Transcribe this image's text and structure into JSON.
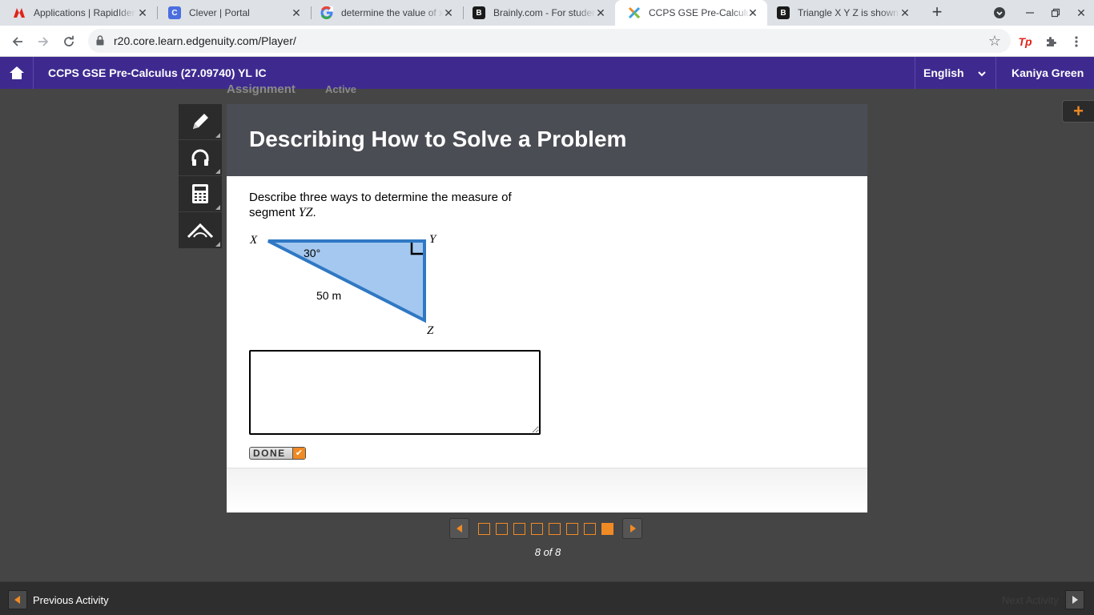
{
  "browser": {
    "tabs": [
      {
        "title": "Applications | RapidIdentity",
        "icon": "rapididentity-icon"
      },
      {
        "title": "Clever | Portal",
        "icon": "clever-icon"
      },
      {
        "title": "determine the value of x",
        "icon": "google-icon"
      },
      {
        "title": "Brainly.com - For students",
        "icon": "brainly-icon"
      },
      {
        "title": "CCPS GSE Pre-Calculus",
        "icon": "edgenuity-icon"
      },
      {
        "title": "Triangle X Y Z is shown",
        "icon": "brainly-icon"
      }
    ],
    "active_tab": 4,
    "url": "r20.core.learn.edgenuity.com/Player/"
  },
  "header": {
    "course_title": "CCPS GSE Pre-Calculus (27.09740) YL IC",
    "language": "English",
    "user": "Kaniya Green",
    "behind_left": "Assignment",
    "behind_right": "Active"
  },
  "activity": {
    "title": "Describing How to Solve a Problem",
    "prompt_text": "Describe three ways to determine the measure of segment ",
    "prompt_var": "YZ",
    "prompt_end": ".",
    "done_label": "DONE"
  },
  "diagram": {
    "vertex_x": "X",
    "vertex_y": "Y",
    "vertex_z": "Z",
    "angle_label": "30°",
    "hyp_label": "50 m",
    "fill": "#a4c8ef",
    "stroke": "#2f78c4"
  },
  "pager": {
    "total": 8,
    "current": 8,
    "label": "8 of 8"
  },
  "footer": {
    "prev": "Previous Activity",
    "next": "Next Activity"
  },
  "colors": {
    "course_bar": "#3e2a8f",
    "accent": "#f08a24"
  }
}
